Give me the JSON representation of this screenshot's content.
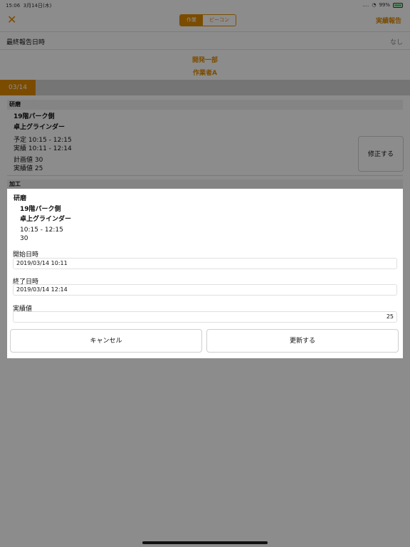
{
  "status": {
    "time": "15:06",
    "date": "3月14日(木)",
    "dots": "....",
    "battery": "99%"
  },
  "nav": {
    "close_icon": "close-icon",
    "seg_work": "作業",
    "seg_beacon": "ビーコン",
    "report": "実績報告"
  },
  "last_report": {
    "label": "最終報告日時",
    "value": "なし"
  },
  "dept": "開発一部",
  "worker": "作業者A",
  "date_tab": "03/14",
  "task1": {
    "section": "研磨",
    "location": "19階パーク側",
    "tool": "卓上グラインダー",
    "planned": "予定 10:15 - 12:15",
    "actual": "実績 10:11 - 12:14",
    "plan_value": "計画値 30",
    "actual_value": "実績値 25",
    "edit_button": "修正する"
  },
  "task2": {
    "section": "加工"
  },
  "modal": {
    "section": "研磨",
    "location": "19階パーク側",
    "tool": "卓上グラインダー",
    "time": "10:15 - 12:15",
    "value": "30",
    "start_label": "開始日時",
    "start_value": "2019/03/14 10:11",
    "end_label": "終了日時",
    "end_value": "2019/03/14 12:14",
    "actual_label": "実績値",
    "actual_value": "25",
    "cancel": "キャンセル",
    "update": "更新する"
  },
  "colors": {
    "accent": "#e08a00",
    "overlay": "rgba(0,0,0,0.45)"
  }
}
